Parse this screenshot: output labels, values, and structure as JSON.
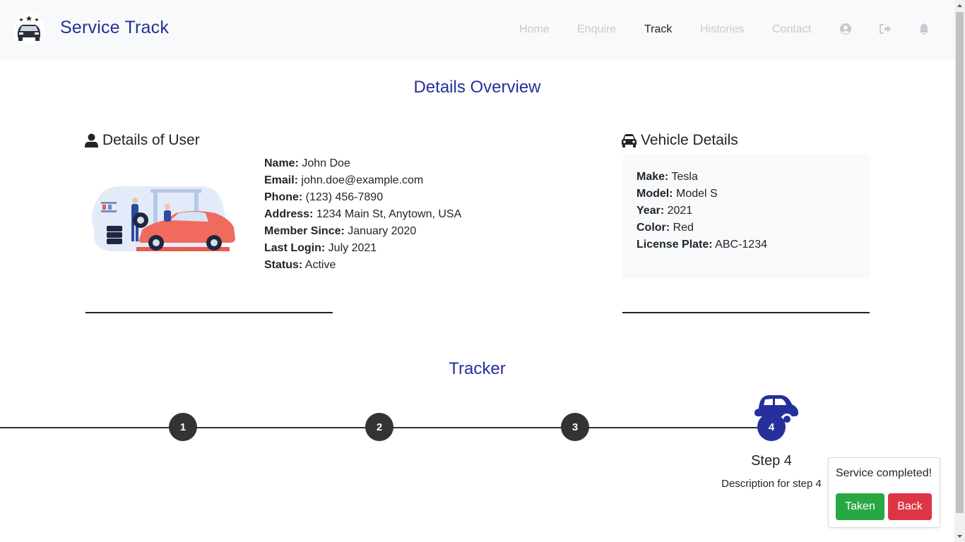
{
  "brand": {
    "title": "Service Track"
  },
  "nav": {
    "links": [
      "Home",
      "Enquire",
      "Track",
      "Histories",
      "Contact"
    ],
    "active": "Track",
    "icons": [
      "user-circle-icon",
      "sign-out-icon",
      "bell-icon"
    ]
  },
  "overview": {
    "title": "Details Overview",
    "user": {
      "heading": "Details of User",
      "fields": [
        {
          "label": "Name:",
          "value": "John Doe"
        },
        {
          "label": "Email:",
          "value": "john.doe@example.com"
        },
        {
          "label": "Phone:",
          "value": "(123) 456-7890"
        },
        {
          "label": "Address:",
          "value": "1234 Main St, Anytown, USA"
        },
        {
          "label": "Member Since:",
          "value": "January 2020"
        },
        {
          "label": "Last Login:",
          "value": "July 2021"
        },
        {
          "label": "Status:",
          "value": "Active"
        }
      ]
    },
    "vehicle": {
      "heading": "Vehicle Details",
      "fields": [
        {
          "label": "Make:",
          "value": "Tesla"
        },
        {
          "label": "Model:",
          "value": "Model S"
        },
        {
          "label": "Year:",
          "value": "2021"
        },
        {
          "label": "Color:",
          "value": "Red"
        },
        {
          "label": "License Plate:",
          "value": "ABC-1234"
        }
      ]
    }
  },
  "tracker": {
    "title": "Tracker",
    "steps": [
      "1",
      "2",
      "3",
      "4"
    ],
    "current_step_title": "Step 4",
    "current_step_desc": "Description for step 4"
  },
  "toast": {
    "message": "Service completed!",
    "taken_label": "Taken",
    "back_label": "Back"
  },
  "colors": {
    "brand": "#25309a",
    "success": "#28a745",
    "danger": "#dc3545",
    "navbar": "#f8f9fa"
  }
}
